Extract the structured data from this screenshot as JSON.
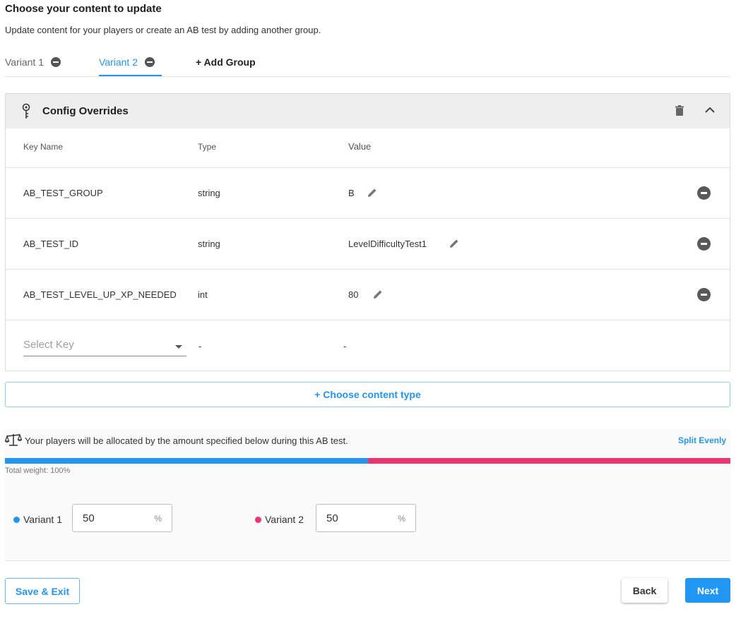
{
  "header": {
    "title": "Choose your content to update",
    "subtitle": "Update content for your players or create an AB test by adding another group."
  },
  "tabs": [
    {
      "label": "Variant 1",
      "active": false
    },
    {
      "label": "Variant 2",
      "active": true
    }
  ],
  "add_group_label": "+ Add Group",
  "config_panel": {
    "title": "Config Overrides",
    "columns": {
      "key": "Key Name",
      "type": "Type",
      "value": "Value"
    },
    "rows": [
      {
        "key": "AB_TEST_GROUP",
        "type": "string",
        "value": "B"
      },
      {
        "key": "AB_TEST_ID",
        "type": "string",
        "value": "LevelDifficultyTest1"
      },
      {
        "key": "AB_TEST_LEVEL_UP_XP_NEEDED",
        "type": "int",
        "value": "80"
      }
    ],
    "new_row": {
      "placeholder": "Select Key",
      "type": "-",
      "value": "-"
    }
  },
  "choose_content_label": "+ Choose content type",
  "allocation": {
    "text": "Your players will be allocated by the amount specified below during this AB test.",
    "split_label": "Split Evenly",
    "total_weight": "Total weight: 100%",
    "variants": [
      {
        "label": "Variant 1",
        "value": "50",
        "unit": "%",
        "color": "#2196f3",
        "weight": 50
      },
      {
        "label": "Variant 2",
        "value": "50",
        "unit": "%",
        "color": "#ec3570",
        "weight": 50
      }
    ]
  },
  "footer": {
    "save_label": "Save & Exit",
    "back_label": "Back",
    "next_label": "Next"
  },
  "colors": {
    "accent": "#2196f3",
    "variant2": "#ec3570"
  }
}
